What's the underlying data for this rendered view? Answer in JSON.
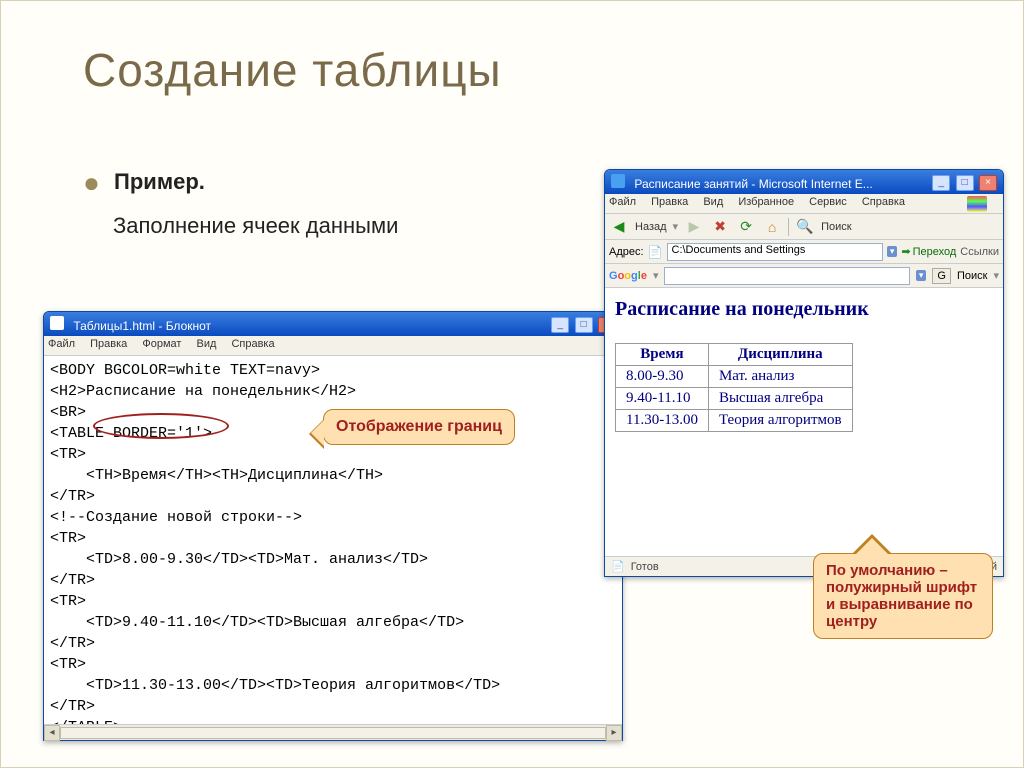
{
  "slide": {
    "title": "Создание таблицы",
    "bullet_label": "Пример.",
    "subline": "Заполнение ячеек данными"
  },
  "notepad": {
    "title": "Таблицы1.html - Блокнот",
    "menu": [
      "Файл",
      "Правка",
      "Формат",
      "Вид",
      "Справка"
    ],
    "code": "<BODY BGCOLOR=white TEXT=navy>\n<H2>Расписание на понедельник</H2>\n<BR>\n<TABLE BORDER='1'>\n<TR>\n    <TH>Время</TH><TH>Дисциплина</TH>\n</TR>\n<!--Создание новой строки-->\n<TR>\n    <TD>8.00-9.30</TD><TD>Мат. анализ</TD>\n</TR>\n<TR>\n    <TD>9.40-11.10</TD><TD>Высшая алгебра</TD>\n</TR>\n<TR>\n    <TD>11.30-13.00</TD><TD>Теория алгоритмов</TD>\n</TR>\n</TABLE>"
  },
  "ie": {
    "title": "Расписание занятий - Microsoft Internet E...",
    "menu": [
      "Файл",
      "Правка",
      "Вид",
      "Избранное",
      "Сервис",
      "Справка"
    ],
    "back_label": "Назад",
    "search_label": "Поиск",
    "addr_label": "Адрес:",
    "url": "C:\\Documents and Settings",
    "goto_label": "Переход",
    "links_label": "Ссылки",
    "google_label": "Google",
    "g_go": "G",
    "g_search": "Поиск",
    "status_done": "Готов",
    "status_zone": "Мой"
  },
  "page": {
    "heading": "Расписание на понедельник",
    "th_time": "Время",
    "th_disc": "Дисциплина",
    "rows": [
      {
        "time": "8.00-9.30",
        "disc": "Мат. анализ"
      },
      {
        "time": "9.40-11.10",
        "disc": "Высшая алгебра"
      },
      {
        "time": "11.30-13.00",
        "disc": "Теория алгоритмов"
      }
    ]
  },
  "callouts": {
    "border_label": "Отображение границ",
    "th_note": "По умолчанию – полужирный шрифт и выравнивание по центру"
  }
}
